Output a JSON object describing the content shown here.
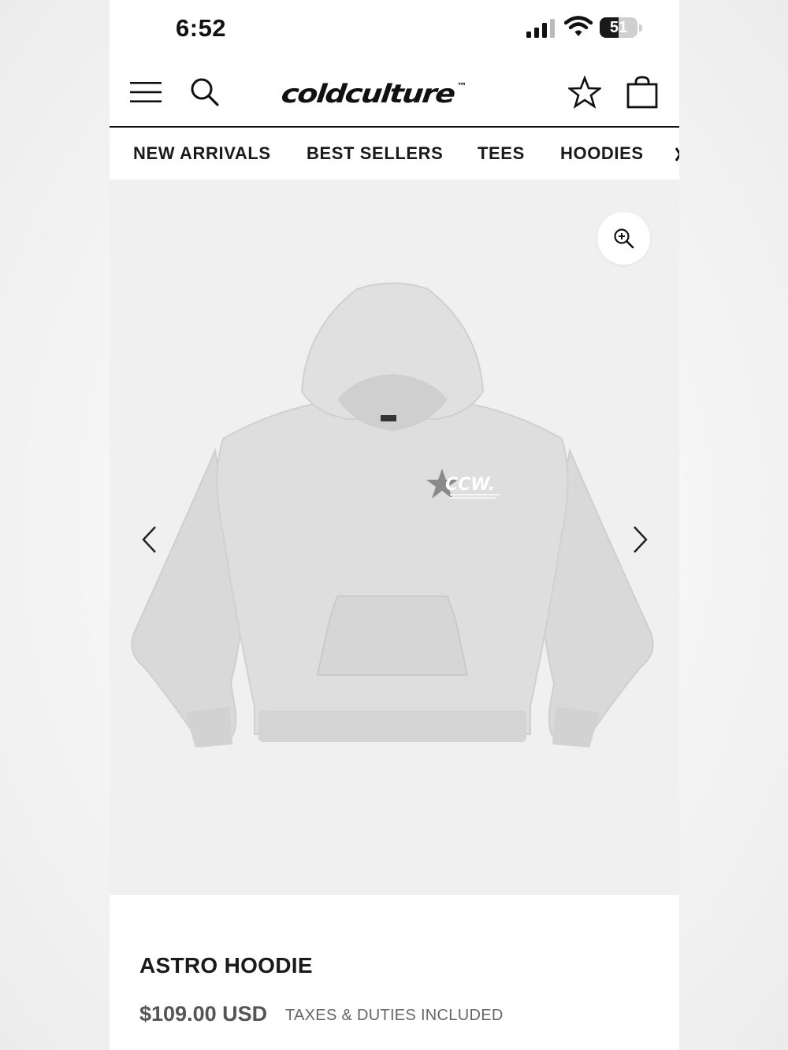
{
  "status_bar": {
    "time": "6:52",
    "battery_percent": "51",
    "battery_level": 0.51
  },
  "header": {
    "logo_text": "coldculture",
    "logo_mark": "™",
    "icons": [
      "menu-icon",
      "search-icon",
      "star-icon",
      "shopping-bag-icon"
    ]
  },
  "category_nav": {
    "items": [
      {
        "label": "NEW ARRIVALS"
      },
      {
        "label": "BEST SELLERS"
      },
      {
        "label": "TEES"
      },
      {
        "label": "HOODIES"
      }
    ]
  },
  "gallery": {
    "zoom_icon": "zoom-in-icon",
    "prev_icon": "chevron-left-icon",
    "next_icon": "chevron-right-icon",
    "print_text": "CCW."
  },
  "product": {
    "title": "ASTRO HOODIE",
    "price": "$109.00 USD",
    "tax_note": "TAXES & DUTIES INCLUDED"
  },
  "colors": {
    "text": "#1a1a1a",
    "gallery_bg": "#f0f0f0",
    "hoodie": "#dcdcdc",
    "price": "#555555"
  }
}
